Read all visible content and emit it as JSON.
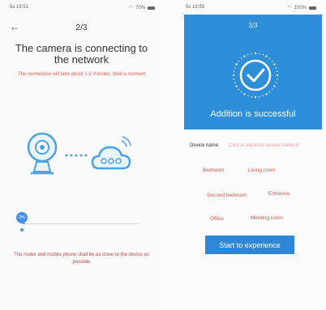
{
  "left": {
    "status_time": "5ᵴ 18:51",
    "status_battery": "70%",
    "step": "2/3",
    "title": "The camera is connecting to the network",
    "subtitle": "The connection will take about 1-2 minutes. Wait a moment",
    "progress_percent": 2,
    "progress_label": "2%",
    "note": "The router and mobile phone shall be as close to the device as possible"
  },
  "right": {
    "status_time": "5ᵴ 18:59",
    "status_battery": "100%",
    "step": "3/3",
    "success_text": "Addition is successful",
    "device_name_label": "Device name",
    "device_name_placeholder": "Click to input the device name or",
    "rooms": [
      "Bedroom",
      "Living room",
      "Second bedroom",
      "Entrance",
      "Office",
      "Meeting room"
    ],
    "start_button": "Start to experience"
  },
  "colors": {
    "accent_blue": "#2f8ed8",
    "hint_red": "#d9534f"
  }
}
